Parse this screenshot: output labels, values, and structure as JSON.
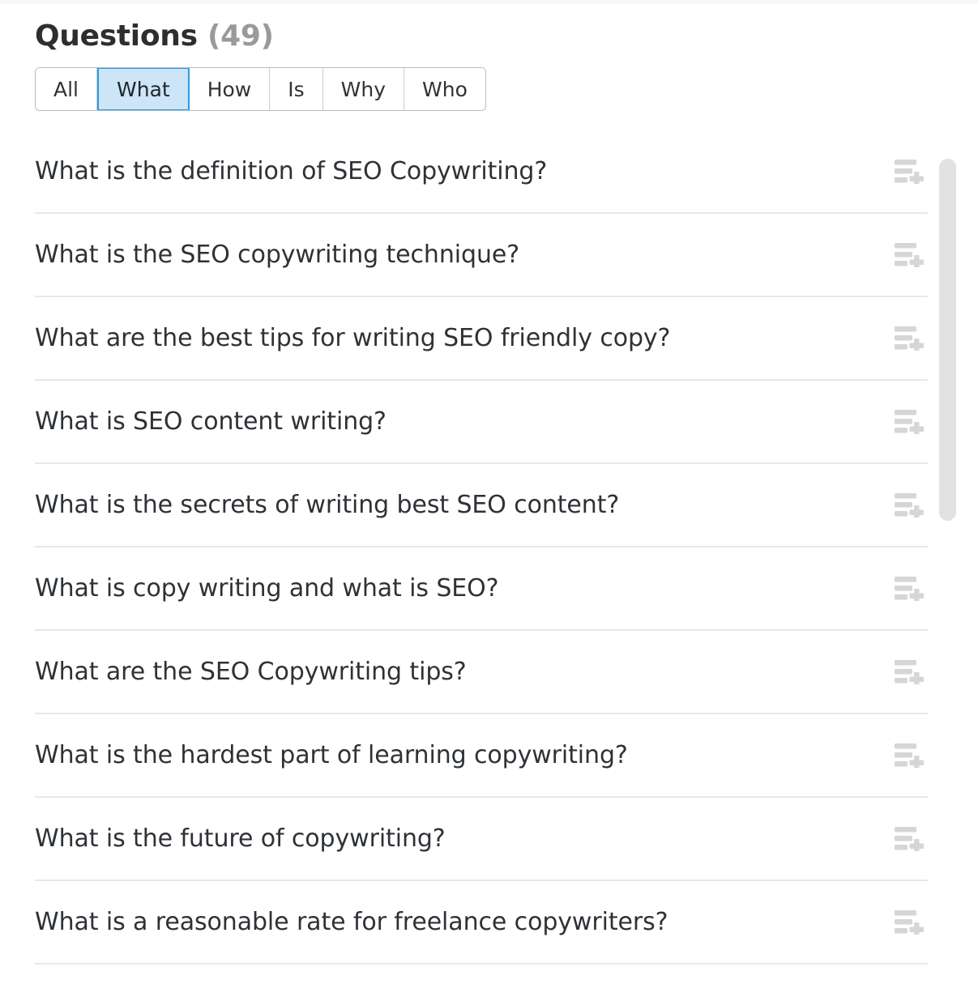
{
  "header": {
    "title": "Questions",
    "count": "(49)"
  },
  "tabs": [
    {
      "label": "All",
      "active": false
    },
    {
      "label": "What",
      "active": true
    },
    {
      "label": "How",
      "active": false
    },
    {
      "label": "Is",
      "active": false
    },
    {
      "label": "Why",
      "active": false
    },
    {
      "label": "Who",
      "active": false
    }
  ],
  "questions": [
    {
      "text": "What is the definition of SEO Copywriting?",
      "action_icon": "add-to-list-icon"
    },
    {
      "text": "What is the SEO copywriting technique?",
      "action_icon": "add-to-list-icon"
    },
    {
      "text": "What are the best tips for writing SEO friendly copy?",
      "action_icon": "add-to-list-icon"
    },
    {
      "text": "What is SEO content writing?",
      "action_icon": "add-to-list-icon"
    },
    {
      "text": "What is the secrets of writing best SEO content?",
      "action_icon": "add-to-list-icon"
    },
    {
      "text": "What is copy writing and what is SEO?",
      "action_icon": "add-to-list-icon"
    },
    {
      "text": "What are the SEO Copywriting tips?",
      "action_icon": "add-to-list-icon"
    },
    {
      "text": "What is the hardest part of learning copywriting?",
      "action_icon": "add-to-list-icon"
    },
    {
      "text": "What is the future of copywriting?",
      "action_icon": "add-to-list-icon"
    },
    {
      "text": "What is a reasonable rate for freelance copywriters?",
      "action_icon": "add-to-list-icon"
    }
  ],
  "colors": {
    "active_tab_background": "#cce5f7",
    "active_tab_border": "#2e9ae0",
    "divider": "#e4e9f0",
    "title_text": "#2e2e2e",
    "count_text": "#9a9a9a",
    "icon": "#d6d6d6",
    "scrollbar_thumb": "#e2e2e2"
  }
}
